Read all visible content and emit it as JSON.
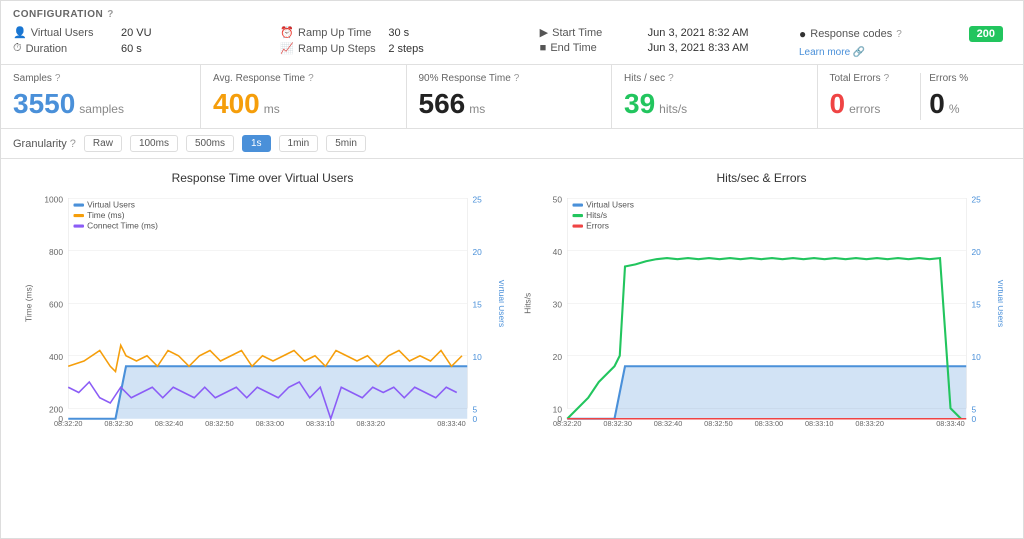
{
  "config": {
    "title": "CONFIGURATION",
    "virtual_users_label": "Virtual Users",
    "virtual_users_value": "20 VU",
    "duration_label": "Duration",
    "duration_value": "60 s",
    "ramp_up_time_label": "Ramp Up Time",
    "ramp_up_time_value": "30 s",
    "ramp_up_steps_label": "Ramp Up Steps",
    "ramp_up_steps_value": "2 steps",
    "start_time_label": "Start Time",
    "start_time_value": "Jun 3, 2021 8:32 AM",
    "end_time_label": "End Time",
    "end_time_value": "Jun 3, 2021 8:33 AM",
    "response_codes_label": "Response codes",
    "response_codes_value": "200",
    "learn_more": "Learn more"
  },
  "stats": {
    "samples_label": "Samples",
    "samples_value": "3550",
    "samples_unit": "samples",
    "avg_response_label": "Avg. Response Time",
    "avg_response_value": "400",
    "avg_response_unit": "ms",
    "p90_response_label": "90% Response Time",
    "p90_response_value": "566",
    "p90_response_unit": "ms",
    "hits_sec_label": "Hits / sec",
    "hits_sec_value": "39",
    "hits_sec_unit": "hits/s",
    "total_errors_label": "Total Errors",
    "total_errors_value": "0",
    "total_errors_unit": "errors",
    "errors_pct_label": "Errors %",
    "errors_pct_value": "0",
    "errors_pct_unit": "%"
  },
  "granularity": {
    "label": "Granularity",
    "options": [
      "Raw",
      "100ms",
      "500ms",
      "1s",
      "1min",
      "5min"
    ],
    "active": "1s"
  },
  "chart1": {
    "title": "Response Time over Virtual Users",
    "legend": [
      {
        "label": "Virtual Users",
        "color": "blue"
      },
      {
        "label": "Time (ms)",
        "color": "orange"
      },
      {
        "label": "Connect Time (ms)",
        "color": "purple"
      }
    ],
    "y_axis_left": "Time (ms)",
    "y_axis_right": "Virtual Users",
    "x_labels": [
      "08:32:20",
      "08:32:30",
      "08:32:40",
      "08:32:50",
      "08:33:00",
      "08:33:10",
      "08:33:20",
      "08:33:40"
    ]
  },
  "chart2": {
    "title": "Hits/sec & Errors",
    "legend": [
      {
        "label": "Virtual Users",
        "color": "blue"
      },
      {
        "label": "Hits/s",
        "color": "green"
      },
      {
        "label": "Errors",
        "color": "red"
      }
    ],
    "y_axis_left": "Hits/s",
    "y_axis_right": "Virtual Users",
    "x_labels": [
      "08:32:20",
      "08:32:30",
      "08:32:40",
      "08:32:50",
      "08:33:00",
      "08:33:10",
      "08:33:20",
      "08:33:40"
    ]
  }
}
